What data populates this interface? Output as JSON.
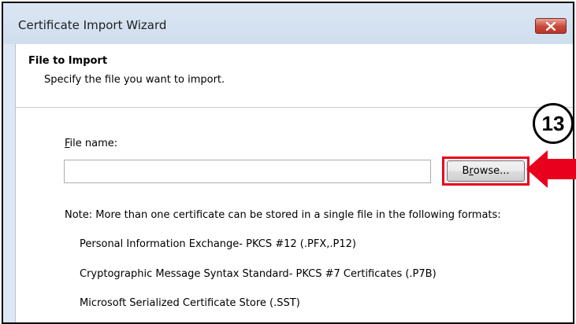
{
  "window": {
    "title": "Certificate Import Wizard"
  },
  "header": {
    "title": "File to Import",
    "subtitle": "Specify the file you want to import."
  },
  "file_name": {
    "label_accel": "F",
    "label_rest": "ile name:",
    "value": "",
    "placeholder": ""
  },
  "browse": {
    "label_pre": "B",
    "label_accel": "r",
    "label_post": "owse..."
  },
  "note": "Note:  More than one certificate can be stored in a single file in the following formats:",
  "formats": [
    "Personal Information Exchange- PKCS #12 (.PFX,.P12)",
    "Cryptographic Message Syntax Standard- PKCS #7 Certificates (.P7B)",
    "Microsoft Serialized Certificate Store (.SST)"
  ],
  "annotation": {
    "step_number": "13",
    "highlight_color": "#e8001c"
  }
}
